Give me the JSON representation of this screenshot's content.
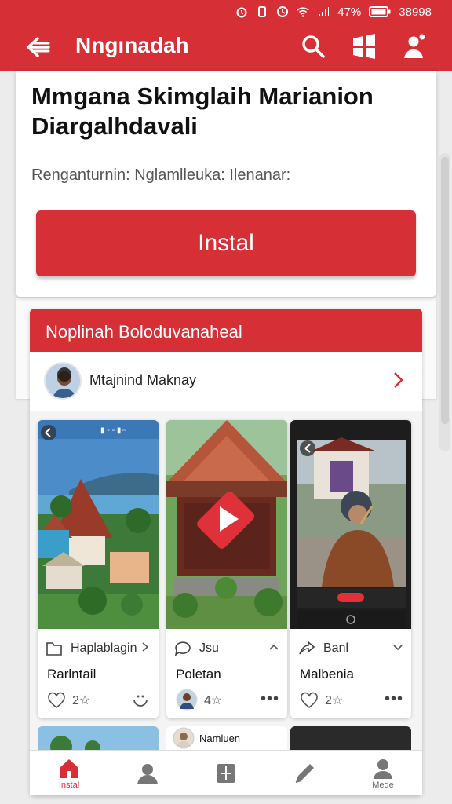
{
  "status_bar": {
    "battery_percent": "47%",
    "time": "38998"
  },
  "app_bar": {
    "title": "Nngınadah",
    "icons": [
      "back-arrow-icon",
      "search-icon",
      "windows-icon",
      "profile-icon"
    ]
  },
  "promo_card": {
    "heading": "Mmgana Skimglaih Marianion Diargalhdavali",
    "subtitle": "Renganturnin: Nglamlleuka: Ilenanar:",
    "install_button": "Instal"
  },
  "feed": {
    "header": "Noplinah Boloduvanaheal",
    "creator": {
      "name": "Mtajnind Maknay"
    },
    "tiles": [
      {
        "meta_label": "Haplablagin",
        "caption": "Rarlntail",
        "count": "2☆",
        "meta_icon": "bookmark-icon",
        "footer_icon": "heart-icon"
      },
      {
        "meta_label": "Jsu",
        "caption": "Poletan",
        "count": "4☆",
        "meta_icon": "comment-icon",
        "footer_icon": "avatar"
      },
      {
        "meta_label": "Banl",
        "caption": "Malbenia",
        "count": "2☆",
        "meta_icon": "share-icon",
        "footer_icon": "heart-icon"
      }
    ],
    "peek_label": "Namluen"
  },
  "bottom_nav": [
    {
      "label": "Instal",
      "icon": "home-icon",
      "active": true
    },
    {
      "label": "",
      "icon": "person-icon",
      "active": false
    },
    {
      "label": "",
      "icon": "grid-icon",
      "active": false
    },
    {
      "label": "",
      "icon": "pen-icon",
      "active": false
    },
    {
      "label": "Mede",
      "icon": "user-icon",
      "active": false
    }
  ],
  "colors": {
    "primary": "#d62f35",
    "background": "#ececec",
    "card": "#ffffff"
  }
}
